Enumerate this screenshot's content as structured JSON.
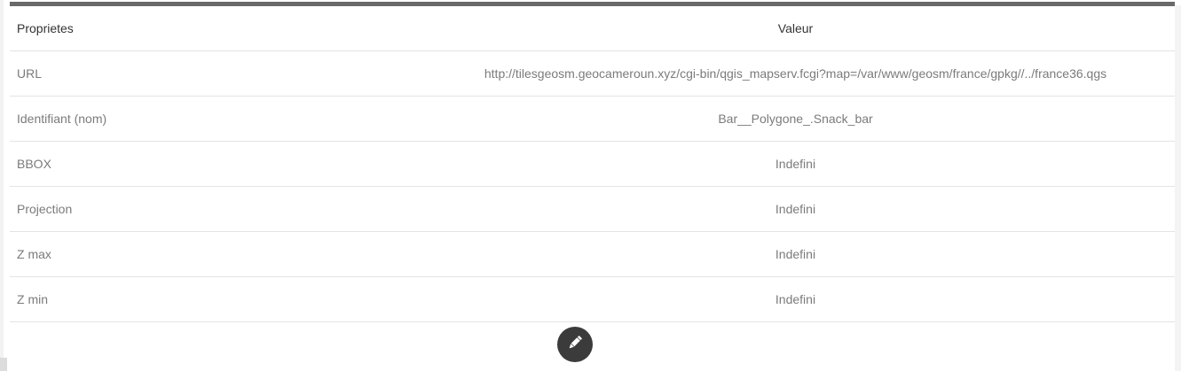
{
  "table": {
    "headers": {
      "property": "Proprietes",
      "value": "Valeur"
    },
    "rows": [
      {
        "property": "URL",
        "value": "http://tilesgeosm.geocameroun.xyz/cgi-bin/qgis_mapserv.fcgi?map=/var/www/geosm/france/gpkg//../france36.qgs"
      },
      {
        "property": "Identifiant (nom)",
        "value": "Bar__Polygone_.Snack_bar"
      },
      {
        "property": "BBOX",
        "value": "Indefini"
      },
      {
        "property": "Projection",
        "value": "Indefini"
      },
      {
        "property": "Z max",
        "value": "Indefini"
      },
      {
        "property": "Z min",
        "value": "Indefini"
      }
    ]
  },
  "actions": {
    "edit_icon": "pencil-icon",
    "button_color": "#3b3b3b"
  }
}
